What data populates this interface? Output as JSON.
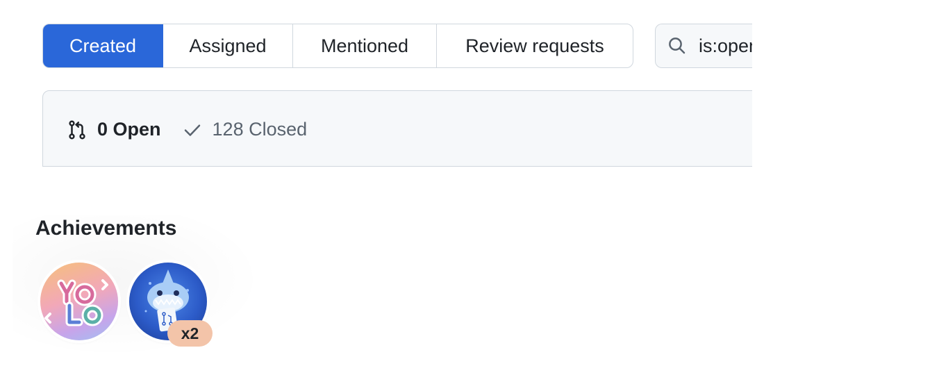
{
  "tabs": [
    {
      "label": "Created",
      "selected": true
    },
    {
      "label": "Assigned",
      "selected": false
    },
    {
      "label": "Mentioned",
      "selected": false
    },
    {
      "label": "Review requests",
      "selected": false
    }
  ],
  "search": {
    "value": "is:open",
    "icon": "search-icon"
  },
  "states": {
    "open": {
      "label": "0 Open",
      "icon": "git-pull-request-icon"
    },
    "closed": {
      "label": "128 Closed",
      "icon": "check-icon"
    }
  },
  "achievements": {
    "title": "Achievements",
    "badges": [
      {
        "name": "yolo-badge",
        "text": "YOLO"
      },
      {
        "name": "pull-shark-badge",
        "count": "x2"
      }
    ]
  },
  "colors": {
    "accent": "#2a67d9",
    "border": "#d0d7de",
    "muted_bg": "#f6f8fa",
    "count_bg": "#f3c4a9"
  }
}
